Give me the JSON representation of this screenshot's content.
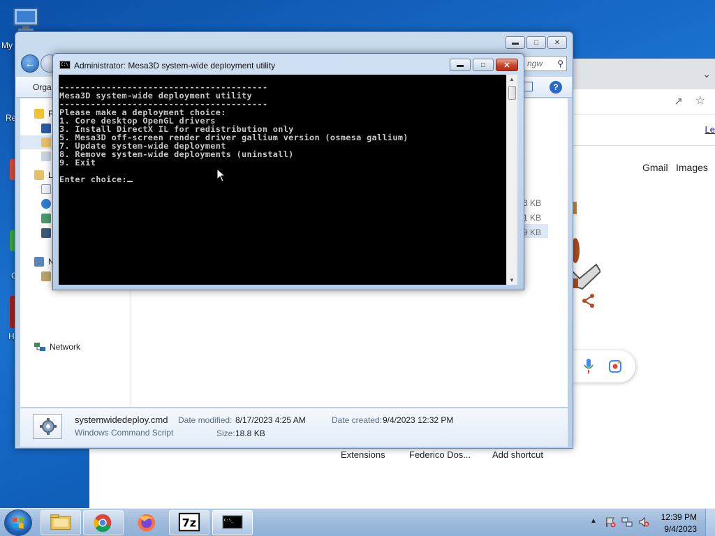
{
  "desktop": {
    "computer_label": "My",
    "recycle_label": "Re",
    "side_letter_1": "C",
    "side_letter_2": "H"
  },
  "chrome": {
    "link_fragment": "Le",
    "gmail": "Gmail",
    "images": "Images",
    "shortcuts": [
      "Extensions",
      "Federico Dos...",
      "Add shortcut"
    ]
  },
  "explorer": {
    "search_placeholder": "ngw",
    "organize_label": "Orga",
    "nav_letters": [
      "F",
      "L",
      "N"
    ],
    "network_label": "Network",
    "sizes": [
      "3 KB",
      "1 KB",
      "9 KB"
    ],
    "details": {
      "file_name": "systemwidedeploy.cmd",
      "file_type": "Windows Command Script",
      "date_modified_label": "Date modified:",
      "date_modified": "8/17/2023 4:25 AM",
      "date_created_label": "Date created:",
      "date_created": "9/4/2023 12:32 PM",
      "size_label": "Size:",
      "size": "18.8 KB"
    }
  },
  "console": {
    "title": "Administrator:  Mesa3D system-wide deployment utility",
    "lines": [
      "----------------------------------------",
      "Mesa3D system-wide deployment utility",
      "----------------------------------------",
      "Please make a deployment choice:",
      "1. Core desktop OpenGL drivers",
      "3. Install DirectX IL for redistribution only",
      "5. Mesa3D off-screen render driver gallium version (osmesa gallium)",
      "7. Update system-wide deployment",
      "8. Remove system-wide deployments (uninstall)",
      "9. Exit",
      "",
      "Enter choice:"
    ]
  },
  "taskbar": {
    "apps": [
      "explorer",
      "chrome",
      "firefox",
      "7-zip",
      "command-prompt"
    ],
    "time": "12:39 PM",
    "date": "9/4/2023"
  }
}
